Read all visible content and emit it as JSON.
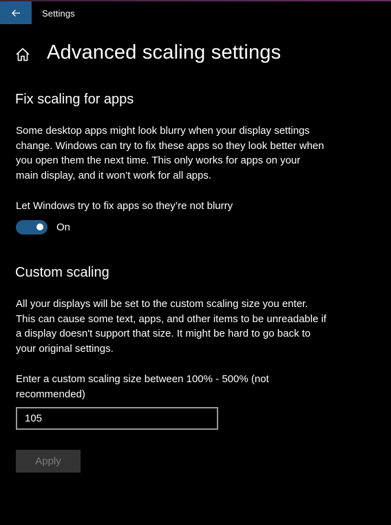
{
  "window": {
    "title": "Settings"
  },
  "page": {
    "title": "Advanced scaling settings"
  },
  "fix_scaling": {
    "heading": "Fix scaling for apps",
    "description_lines": [
      "Some desktop apps might look blurry when your display settings",
      "change. Windows can try to fix these apps so they look better when",
      "you open them the next time. This only works for apps on your",
      "main display, and it won’t work for all apps."
    ],
    "toggle_label": "Let Windows try to fix apps so they’re not blurry",
    "toggle_state": "On",
    "toggle_on": true
  },
  "custom_scaling": {
    "heading": "Custom scaling",
    "description_lines": [
      "All your displays will be set to the custom scaling size you enter.",
      "This can cause some text, apps, and other items to be unreadable if",
      "a display doesn't support that size. It might be hard to go back to",
      "your original settings."
    ],
    "input_label_lines": [
      "Enter a custom scaling size between 100% - 500% (not",
      "recommended)"
    ],
    "input_value": "105",
    "apply_label": "Apply"
  },
  "colors": {
    "accent": "#1f5a8a",
    "background": "#000000",
    "disabled_button": "#333333",
    "disabled_text": "#7a7a7a"
  },
  "icons": {
    "back": "back-arrow-icon",
    "home": "home-icon"
  }
}
